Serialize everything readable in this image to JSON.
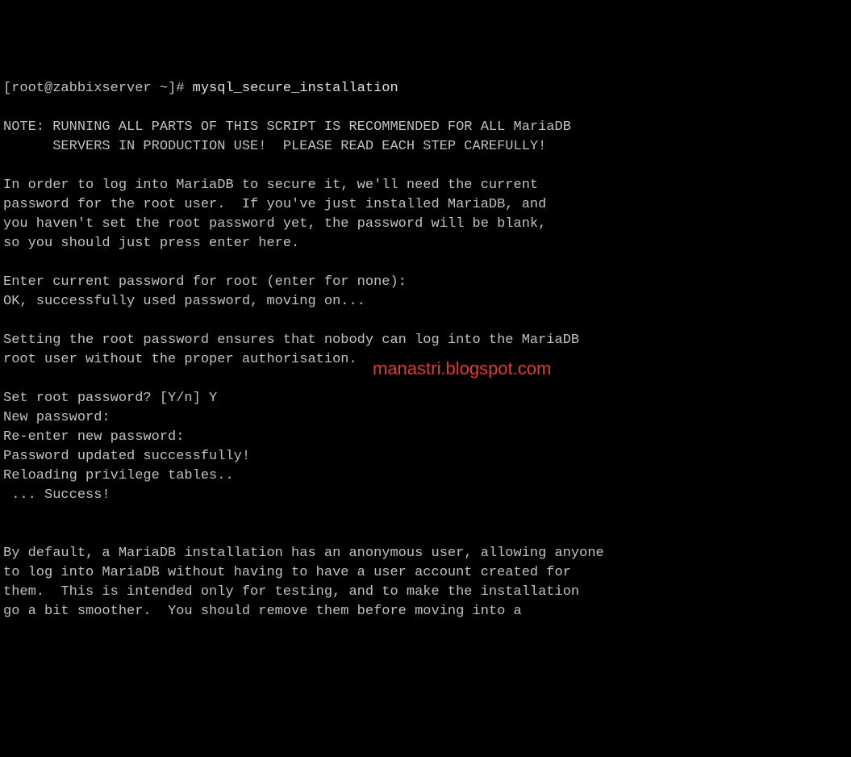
{
  "prompt": {
    "open_bracket": "[",
    "user_host": "root@zabbixserver ~",
    "close_bracket": "]#",
    "command": "mysql_secure_installation"
  },
  "lines": {
    "l0": "",
    "l1": "NOTE: RUNNING ALL PARTS OF THIS SCRIPT IS RECOMMENDED FOR ALL MariaDB",
    "l2": "      SERVERS IN PRODUCTION USE!  PLEASE READ EACH STEP CAREFULLY!",
    "l3": "",
    "l4": "In order to log into MariaDB to secure it, we'll need the current",
    "l5": "password for the root user.  If you've just installed MariaDB, and",
    "l6": "you haven't set the root password yet, the password will be blank,",
    "l7": "so you should just press enter here.",
    "l8": "",
    "l9": "Enter current password for root (enter for none):",
    "l10": "OK, successfully used password, moving on...",
    "l11": "",
    "l12": "Setting the root password ensures that nobody can log into the MariaDB",
    "l13": "root user without the proper authorisation.",
    "l14": "",
    "l15": "Set root password? [Y/n] Y",
    "l16": "New password:",
    "l17": "Re-enter new password:",
    "l18": "Password updated successfully!",
    "l19": "Reloading privilege tables..",
    "l20": " ... Success!",
    "l21": "",
    "l22": "",
    "l23": "By default, a MariaDB installation has an anonymous user, allowing anyone",
    "l24": "to log into MariaDB without having to have a user account created for",
    "l25": "them.  This is intended only for testing, and to make the installation",
    "l26": "go a bit smoother.  You should remove them before moving into a"
  },
  "watermark": "manastri.blogspot.com"
}
